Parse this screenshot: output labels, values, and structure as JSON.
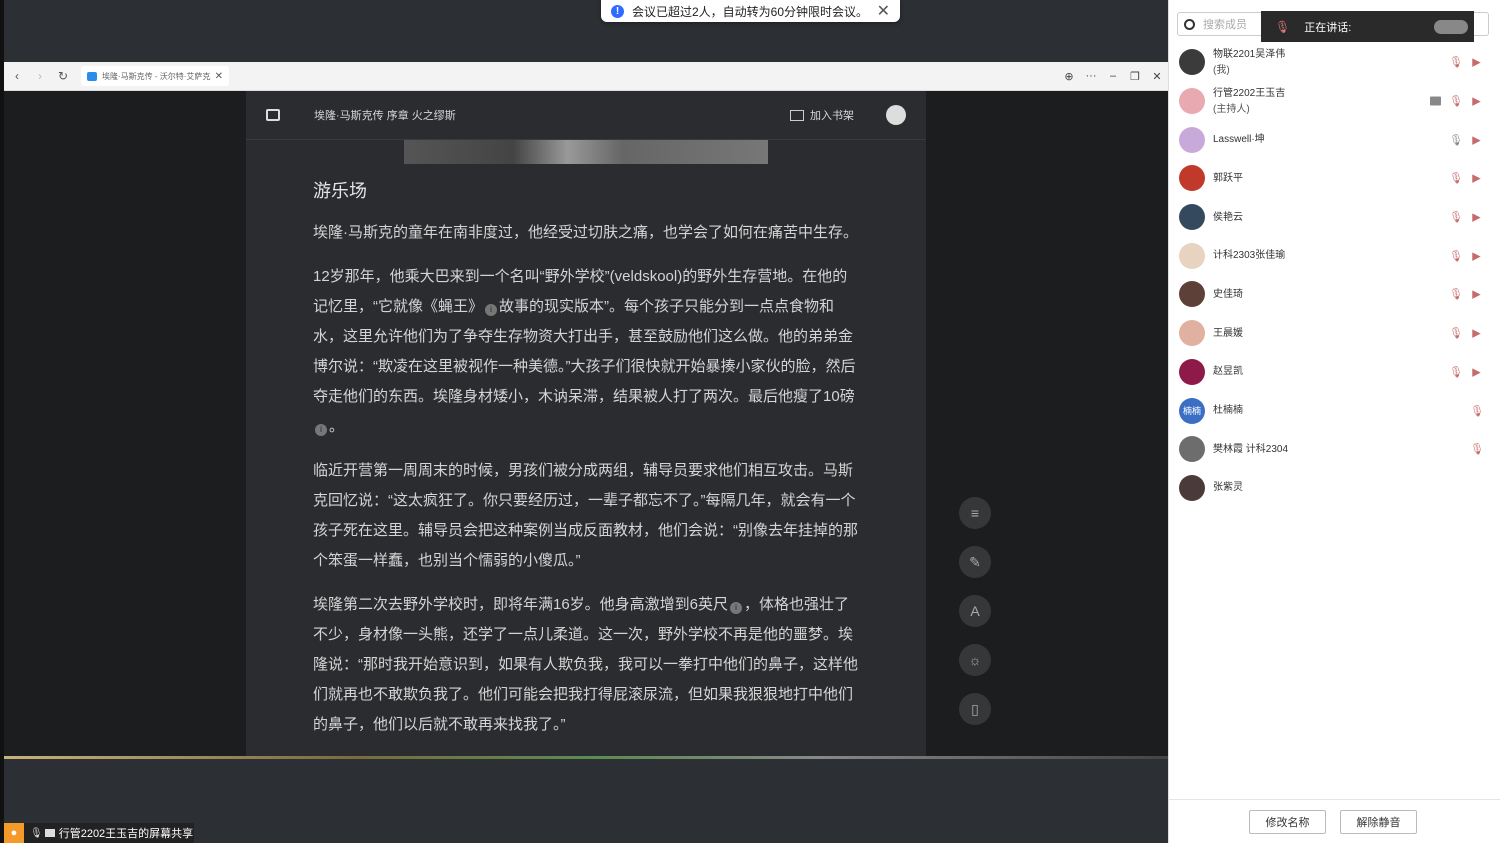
{
  "notice": {
    "text": "会议已超过2人，自动转为60分钟限时会议。",
    "close": "✕"
  },
  "browser": {
    "tab_title": "埃隆·马斯克传 - 沃尔特·艾萨克森",
    "tab_close": "✕",
    "nav": {
      "back": "‹",
      "forward": "›",
      "reload": "↻"
    },
    "window": {
      "globe": "⊕",
      "more": "···",
      "minimize": "–",
      "restore": "❐",
      "close": "✕"
    }
  },
  "reader": {
    "header_title": "埃隆·马斯克传 序章 火之缪斯",
    "shelf_label": "加入书架",
    "chapter_title": "游乐场",
    "paragraphs": [
      [
        "埃隆·马斯克的童年在南非度过，他经受过切肤之痛，也学会了如何在痛苦中生存。"
      ],
      [
        "12岁那年，他乘大巴来到一个名叫“野外学校”(veldskool)的野外生存营地。在他的记忆里，“它就像《蝇王》",
        "故事的现实版本”。每个孩子只能分到一点点食物和水，这里允许他们为了争夺生存物资大打出手，甚至鼓励他们这么做。他的弟弟金博尔说：“欺凌在这里被视作一种美德。”大孩子们很快就开始暴揍小家伙的脸，然后夺走他们的东西。埃隆身材矮小，木讷呆滞，结果被人打了两次。最后他瘦了10磅",
        "。"
      ],
      [
        "临近开营第一周周末的时候，男孩们被分成两组，辅导员要求他们相互攻击。马斯克回忆说：“这太疯狂了。你只要经历过，一辈子都忘不了。”每隔几年，就会有一个孩子死在这里。辅导员会把这种案例当成反面教材，他们会说：“别像去年挂掉的那个笨蛋一样蠢，也别当个懦弱的小傻瓜。”"
      ],
      [
        "埃隆第二次去野外学校时，即将年满16岁。他身高激增到6英尺",
        "，体格也强壮了不少，身材像一头熊，还学了一点儿柔道。这一次，野外学校不再是他的噩梦。埃隆说：“那时我开始意识到，如果有人欺负我，我可以一拳打中他们的鼻子，这样他们就再也不敢欺负我了。他们可能会把我打得屁滚尿流，但如果我狠狠地打中他们的鼻子，他们以后就不敢再来找我了。”"
      ]
    ],
    "footnote_mark": "㊟",
    "tools": [
      "≡",
      "✎",
      "A",
      "☼",
      "▯"
    ]
  },
  "share_bar": {
    "label": "行管2202王玉吉的屏幕共享"
  },
  "panel": {
    "search_placeholder": "搜索成员",
    "speaking_label": "正在讲话:",
    "members": [
      {
        "name": "物联2201吴泽伟",
        "sub": "(我)",
        "avatar_color": "#3b3b3b",
        "mic": "muted",
        "cam": "off",
        "screen": false
      },
      {
        "name": "行管2202王玉吉",
        "sub": "(主持人)",
        "avatar_color": "#e8a9b0",
        "mic": "muted",
        "cam": "off",
        "screen": true
      },
      {
        "name": "Lasswell·坤",
        "sub": "",
        "avatar_color": "#c9a9d9",
        "mic": "on",
        "cam": "off",
        "screen": false
      },
      {
        "name": "郭跃平",
        "sub": "",
        "avatar_color": "#c0392b",
        "mic": "muted",
        "cam": "off",
        "screen": false
      },
      {
        "name": "侯艳云",
        "sub": "",
        "avatar_color": "#34495e",
        "mic": "muted",
        "cam": "off",
        "screen": false
      },
      {
        "name": "计科2303张佳瑜",
        "sub": "",
        "avatar_color": "#e8d2c0",
        "mic": "muted",
        "cam": "off",
        "screen": false
      },
      {
        "name": "史佳琦",
        "sub": "",
        "avatar_color": "#5d4037",
        "mic": "muted",
        "cam": "off",
        "screen": false
      },
      {
        "name": "王晨媛",
        "sub": "",
        "avatar_color": "#e0b0a0",
        "mic": "muted",
        "cam": "off",
        "screen": false
      },
      {
        "name": "赵昱凯",
        "sub": "",
        "avatar_color": "#8e1a4a",
        "mic": "muted",
        "cam": "off",
        "screen": false
      },
      {
        "name": "杜楠楠",
        "sub": "",
        "avatar_color": "#3b6fc4",
        "avatar_text": "楠楠",
        "mic": "muted",
        "cam": "none",
        "screen": false
      },
      {
        "name": "樊林霞 计科2304",
        "sub": "",
        "avatar_color": "#6d6d6d",
        "mic": "muted",
        "cam": "none",
        "screen": false
      },
      {
        "name": "张紫灵",
        "sub": "",
        "avatar_color": "#4a3a3a",
        "mic": "none",
        "cam": "none",
        "screen": false
      }
    ],
    "rename_button": "修改名称",
    "unmute_button": "解除静音"
  },
  "icons": {
    "mic_glyph": "🎙",
    "cam_glyph": "▶"
  }
}
